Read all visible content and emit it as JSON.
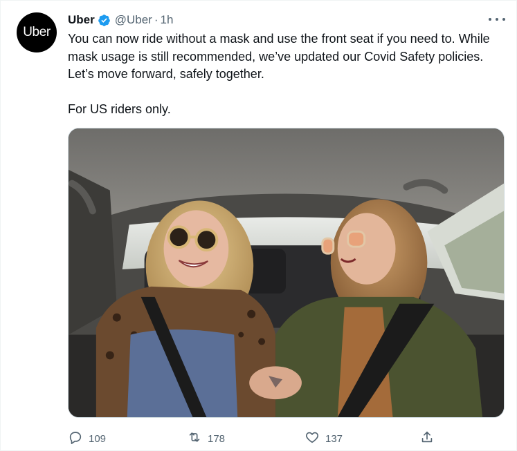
{
  "author": {
    "avatar_text": "Uber",
    "name": "Uber",
    "handle": "@Uber",
    "separator": "·",
    "time": "1h"
  },
  "tweet": {
    "line1": "You can now ride without a mask and use the front seat if you need to. While mask usage is still recommended, we’ve updated our Covid Safety policies. Let’s move forward, safely together.",
    "line2": "For US riders only."
  },
  "media": {
    "kind": "photo"
  },
  "actions": {
    "reply_count": "109",
    "retweet_count": "178",
    "like_count": "137"
  },
  "colors": {
    "verified_blue": "#1d9bf0",
    "secondary_text": "#536471",
    "primary_text": "#0f1419"
  },
  "icons": [
    "verified-icon",
    "more-icon",
    "reply-icon",
    "retweet-icon",
    "like-icon",
    "share-icon"
  ]
}
